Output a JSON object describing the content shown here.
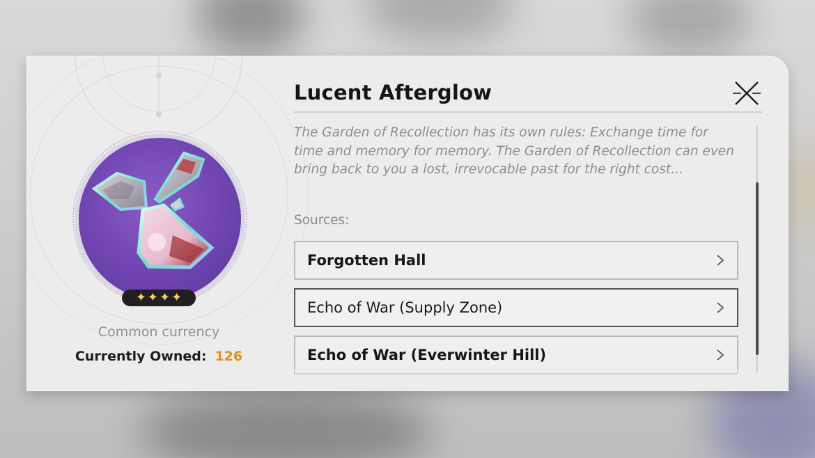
{
  "item": {
    "name": "Lucent Afterglow",
    "rarity_stars": 4,
    "star_glyphs": [
      "✦",
      "✦",
      "✦",
      "✦"
    ],
    "category": "Common currency",
    "owned_label": "Currently Owned:",
    "owned_count": "126",
    "description": "The Garden of Recollection has its own rules: Exchange time for time and memory for memory. The Garden of Recollection can even bring back to you a lost, irrevocable past for the right cost..."
  },
  "sources": {
    "label": "Sources:",
    "items": [
      {
        "label": "Forgotten Hall",
        "selected": false
      },
      {
        "label": "Echo of War (Supply Zone)",
        "selected": true
      },
      {
        "label": "Echo of War (Everwinter Hill)",
        "selected": false
      }
    ]
  },
  "icons": {
    "close": "close-icon",
    "chevron": "chevron-right-icon",
    "star": "star-icon"
  },
  "colors": {
    "owned_count": "#e28f1d",
    "item_background": "#6f44b0",
    "star": "#f2cd68",
    "panel": "#ececec"
  }
}
